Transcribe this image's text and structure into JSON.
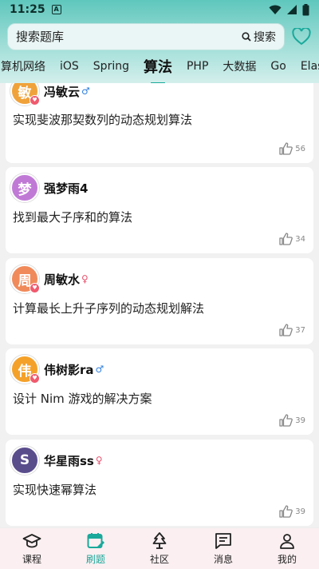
{
  "status": {
    "time": "11:25",
    "notif_letter": "A"
  },
  "search": {
    "placeholder": "搜索题库",
    "button_label": "搜索"
  },
  "tabs": [
    {
      "label": "算机网络"
    },
    {
      "label": "iOS"
    },
    {
      "label": "Spring"
    },
    {
      "label": "算法"
    },
    {
      "label": "PHP"
    },
    {
      "label": "大数据"
    },
    {
      "label": "Go"
    },
    {
      "label": "Elasti"
    }
  ],
  "active_tab": "算法",
  "colors": {
    "accent": "#1aa99b",
    "header_top": "#5fc7bd",
    "nav_bg": "#fbeff1"
  },
  "posts": [
    {
      "avatar_char": "敏",
      "avatar_color": "#f0a23a",
      "name": "冯敏云",
      "gender": "♂",
      "gender_type": "male",
      "title": "实现斐波那契数列的动态规划算法",
      "likes": "56",
      "verified": true
    },
    {
      "avatar_char": "梦",
      "avatar_color": "#c07ad6",
      "name": "强梦雨4",
      "gender": "",
      "gender_type": "none",
      "title": "找到最大子序和的算法",
      "likes": "34",
      "verified": false
    },
    {
      "avatar_char": "周",
      "avatar_color": "#f08a5a",
      "name": "周敏水",
      "gender": "♀",
      "gender_type": "female",
      "title": "计算最长上升子序列的动态规划解法",
      "likes": "37",
      "verified": true
    },
    {
      "avatar_char": "伟",
      "avatar_color": "#f4a12a",
      "name": "伟树影ra",
      "gender": "♂",
      "gender_type": "male",
      "title": "设计 Nim 游戏的解决方案",
      "likes": "39",
      "verified": true
    },
    {
      "avatar_char": "S",
      "avatar_color": "#5a4d8c",
      "name": "华星雨ss",
      "gender": "♀",
      "gender_type": "female",
      "title": "实现快速幂算法",
      "likes": "39",
      "verified": false
    }
  ],
  "nav": [
    {
      "label": "课程",
      "icon": "graduation-cap-icon"
    },
    {
      "label": "刷题",
      "icon": "calendar-edit-icon"
    },
    {
      "label": "社区",
      "icon": "tree-icon"
    },
    {
      "label": "消息",
      "icon": "message-icon"
    },
    {
      "label": "我的",
      "icon": "user-icon"
    }
  ],
  "active_nav": "刷题"
}
